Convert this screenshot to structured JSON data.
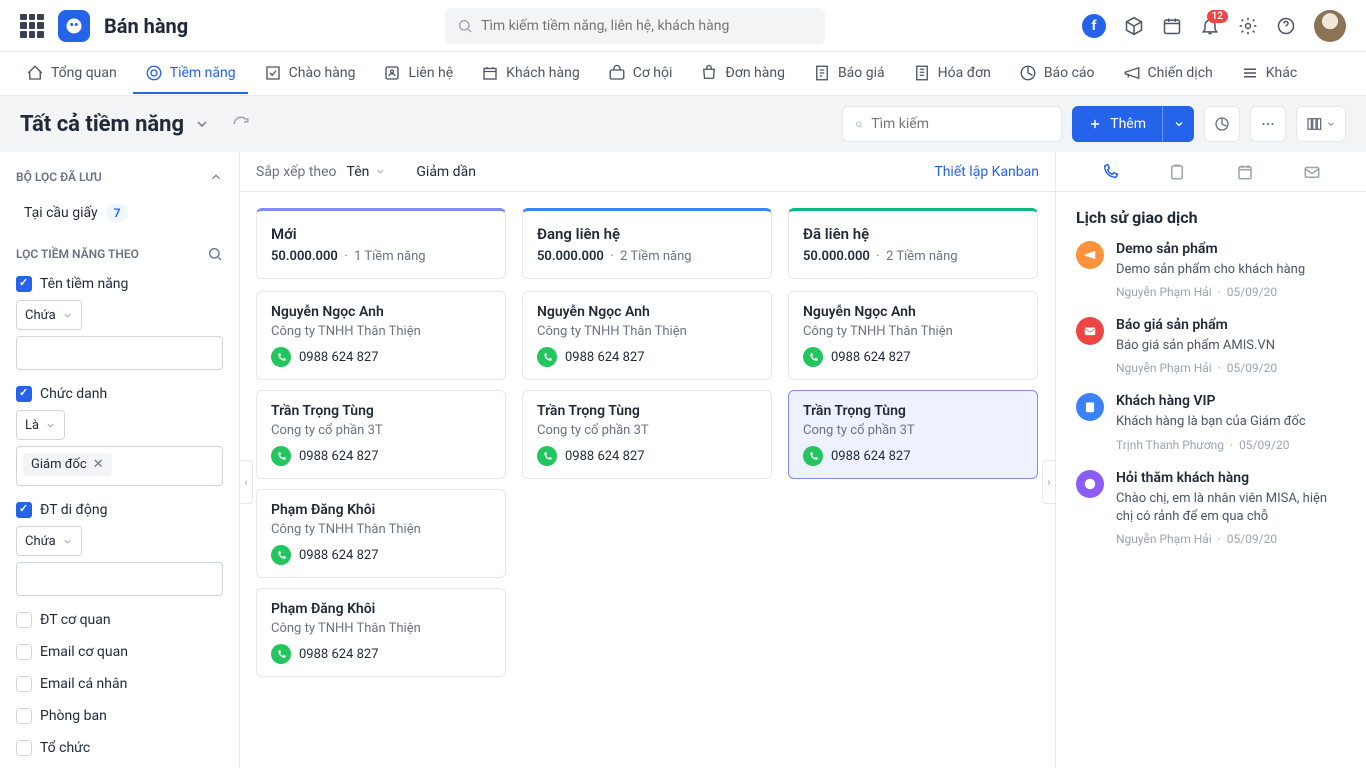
{
  "app": {
    "title": "Bán hàng"
  },
  "topbar": {
    "search_placeholder": "Tìm kiếm tiềm năng, liên hệ, khách hàng",
    "notif_count": "12"
  },
  "nav": {
    "items": [
      {
        "label": "Tổng quan"
      },
      {
        "label": "Tiềm năng"
      },
      {
        "label": "Chào hàng"
      },
      {
        "label": "Liên hệ"
      },
      {
        "label": "Khách hàng"
      },
      {
        "label": "Cơ hội"
      },
      {
        "label": "Đơn hàng"
      },
      {
        "label": "Báo giá"
      },
      {
        "label": "Hóa đơn"
      },
      {
        "label": "Báo cáo"
      },
      {
        "label": "Chiến dịch"
      },
      {
        "label": "Khác"
      }
    ]
  },
  "subheader": {
    "title": "Tất cả tiềm năng",
    "search_placeholder": "Tìm kiếm",
    "add_label": "Thêm"
  },
  "sidebar": {
    "saved_title": "BỘ LỌC ĐÃ LƯU",
    "saved_filter": "Tại cầu giấy",
    "saved_count": "7",
    "filter_title": "LỌC TIỀM NĂNG THEO",
    "f1_label": "Tên tiềm năng",
    "f1_op": "Chứa",
    "f2_label": "Chức danh",
    "f2_op": "Là",
    "f2_tag": "Giám đốc",
    "f3_label": "ĐT di động",
    "f3_op": "Chứa",
    "u1": "ĐT cơ quan",
    "u2": "Email cơ quan",
    "u3": "Email cá nhân",
    "u4": "Phòng ban",
    "u5": "Tổ chức"
  },
  "kanban": {
    "sort_label": "Sắp xếp theo",
    "sort_value": "Tên",
    "sort_dir": "Giảm dần",
    "setup_link": "Thiết lập Kanban",
    "cols": [
      {
        "title": "Mới",
        "amount": "50.000.000",
        "count": "1 Tiềm năng"
      },
      {
        "title": "Đang liên hệ",
        "amount": "50.000.000",
        "count": "2 Tiềm năng"
      },
      {
        "title": "Đã liên hệ",
        "amount": "50.000.000",
        "count": "2 Tiềm năng"
      }
    ],
    "cards": {
      "c1": [
        {
          "name": "Nguyễn Ngọc Anh",
          "company": "Công ty TNHH Thân Thiện",
          "phone": "0988 624 827"
        },
        {
          "name": "Trần Trọng Tùng",
          "company": "Cong ty cổ phần 3T",
          "phone": "0988 624 827"
        },
        {
          "name": "Phạm Đăng Khôi",
          "company": "Công ty TNHH Thân Thiện",
          "phone": "0988 624 827"
        },
        {
          "name": "Phạm Đăng Khôi",
          "company": "Công ty TNHH Thân Thiện",
          "phone": "0988 624 827"
        }
      ],
      "c2": [
        {
          "name": "Nguyễn Ngọc Anh",
          "company": "Công ty TNHH Thân Thiện",
          "phone": "0988 624 827"
        },
        {
          "name": "Trần Trọng Tùng",
          "company": "Cong ty cổ phần 3T",
          "phone": "0988 624 827"
        }
      ],
      "c3": [
        {
          "name": "Nguyễn Ngọc Anh",
          "company": "Công ty TNHH Thân Thiện",
          "phone": "0988 624 827"
        },
        {
          "name": "Trần Trọng Tùng",
          "company": "Cong ty cổ phần 3T",
          "phone": "0988 624 827"
        }
      ]
    }
  },
  "rightpanel": {
    "title": "Lịch sử giao dịch",
    "items": [
      {
        "title": "Demo sản phẩm",
        "desc": "Demo sản phẩm cho khách hàng",
        "author": "Nguyễn Phạm Hải",
        "date": "05/09/20"
      },
      {
        "title": "Báo giá sản phẩm",
        "desc": "Báo giá sản phẩm AMIS.VN",
        "author": "Nguyễn Phạm Hải",
        "date": "05/09/20"
      },
      {
        "title": "Khách hàng VIP",
        "desc": "Khách hàng là bạn của Giám đốc",
        "author": "Trịnh Thanh Phương",
        "date": "05/09/20"
      },
      {
        "title": "Hỏi thăm khách hàng",
        "desc": "Chào chị, em là nhân viên MISA, hiện chị có rảnh để em qua chỗ",
        "author": "Nguyễn Phạm Hải",
        "date": "05/09/20"
      }
    ]
  }
}
